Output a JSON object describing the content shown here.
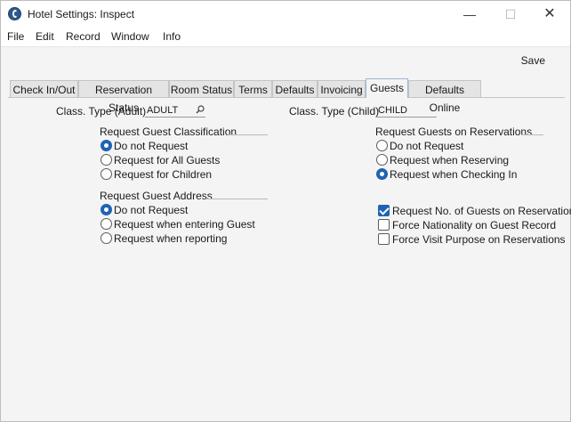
{
  "window": {
    "title": "Hotel Settings: Inspect"
  },
  "controls": {
    "minimize": "—",
    "maximize": "☐",
    "close": "✕"
  },
  "menu": [
    "File",
    "Edit",
    "Record",
    "Window",
    "Info"
  ],
  "toolbar": {
    "save_label": "Save"
  },
  "tabs": [
    "Check In/Out",
    "Reservation Status",
    "Room Status",
    "Terms",
    "Defaults",
    "Invoicing",
    "Guests",
    "Defaults Online"
  ],
  "active_tab": "Guests",
  "fields": {
    "class_adult": {
      "label": "Class. Type (Adult)",
      "value": "ADULT"
    },
    "class_child": {
      "label": "Class. Type (Child)",
      "value": "CHILD"
    }
  },
  "guest_classification": {
    "title": "Request Guest Classification",
    "options": [
      "Do not Request",
      "Request for All Guests",
      "Request for Children"
    ],
    "selected": 0
  },
  "guest_address": {
    "title": "Request Guest Address",
    "options": [
      "Do not Request",
      "Request when entering Guest",
      "Request when reporting"
    ],
    "selected": 0
  },
  "guests_on_reservations": {
    "title": "Request Guests on Reservations",
    "options": [
      "Do not Request",
      "Request when Reserving",
      "Request when Checking In"
    ],
    "selected": 2
  },
  "checkboxes": [
    {
      "label": "Request No. of Guests on Reservations",
      "checked": true
    },
    {
      "label": "Force Nationality on Guest Record",
      "checked": false
    },
    {
      "label": "Force Visit Purpose on Reservations",
      "checked": false
    }
  ]
}
